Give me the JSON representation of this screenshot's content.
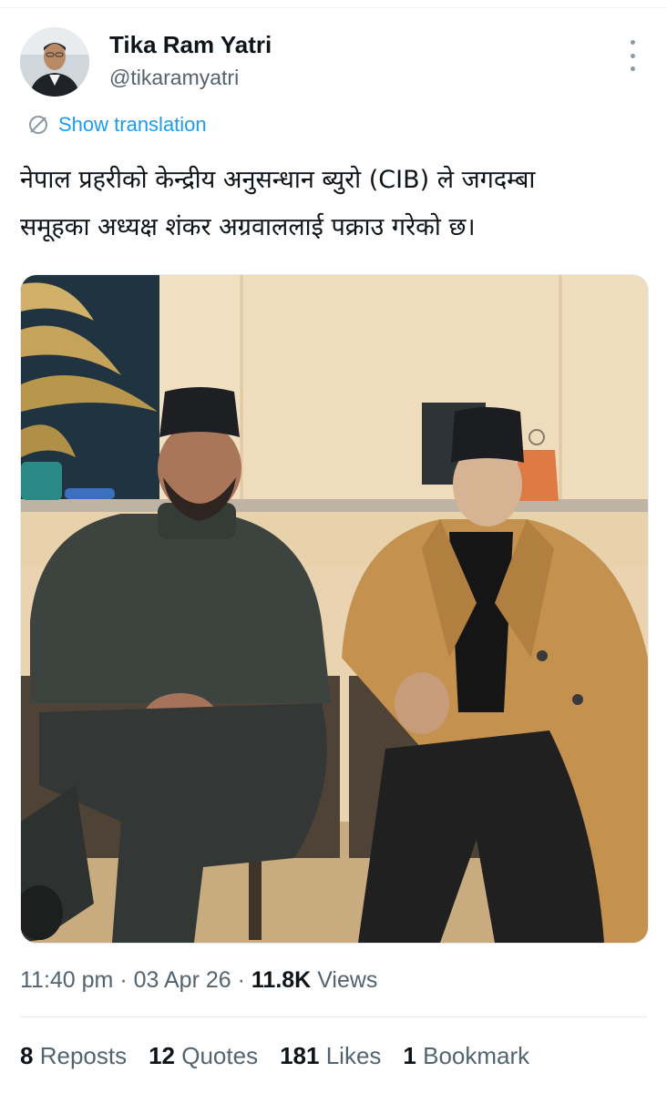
{
  "author": {
    "name": "Tika Ram Yatri",
    "handle": "@tikaramyatri"
  },
  "translate": {
    "label": "Show translation",
    "icon": "translate-icon"
  },
  "tweet": {
    "line1": "नेपाल प्रहरीको केन्द्रीय अनुसन्धान ब्युरो (CIB) ले जगदम्बा",
    "line2": "समूहका अध्यक्ष शंकर अग्रवाललाई पक्राउ गरेको छ।"
  },
  "meta": {
    "time": "11:40 pm",
    "sep1": "·",
    "date": "03 Apr 26",
    "sep2": "·",
    "views_count": "11.8K",
    "views_label": "Views"
  },
  "stats": {
    "reposts_count": "8",
    "reposts_label": "Reposts",
    "quotes_count": "12",
    "quotes_label": "Quotes",
    "likes_count": "181",
    "likes_label": "Likes",
    "bookmarks_count": "1",
    "bookmarks_label": "Bookmark"
  },
  "colors": {
    "link_blue": "#1d9bf0",
    "secondary_text": "#536471",
    "primary_text": "#0f1419"
  }
}
